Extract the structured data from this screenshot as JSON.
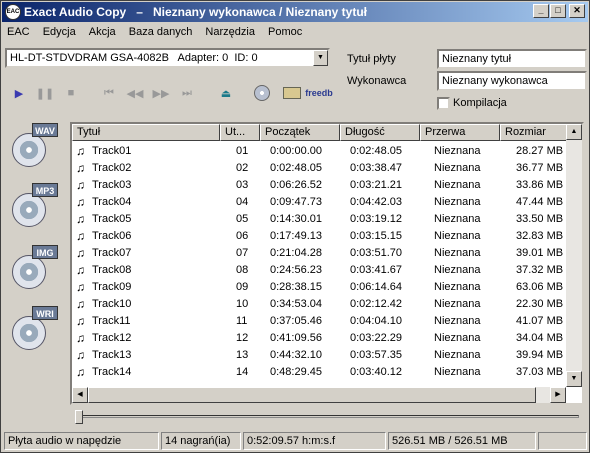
{
  "title": {
    "app": "Exact Audio Copy",
    "separator": "–",
    "album": "Nieznany wykonawca / Nieznany tytuł"
  },
  "menu": [
    "EAC",
    "Edycja",
    "Akcja",
    "Baza danych",
    "Narzędzia",
    "Pomoc"
  ],
  "drive": {
    "selected": "HL-DT-STDVDRAM GSA-4082B   Adapter: 0  ID: 0"
  },
  "fields": {
    "album_title_label": "Tytuł płyty",
    "album_title_value": "Nieznany tytuł",
    "artist_label": "Wykonawca",
    "artist_value": "Nieznany wykonawca",
    "compilation_label": "Kompilacja"
  },
  "transport_icons": [
    "play-icon",
    "pause-icon",
    "stop-icon",
    "first-track-icon",
    "rewind-icon",
    "fast-forward-icon",
    "last-track-icon",
    "eject-icon",
    "cd-icon",
    "network-icon",
    "freedb-icon"
  ],
  "freedb_label": "freedb",
  "side_buttons": [
    {
      "tag": "WAV",
      "name": "copy-wav-button"
    },
    {
      "tag": "MP3",
      "name": "copy-mp3-button"
    },
    {
      "tag": "IMG",
      "name": "copy-image-button"
    },
    {
      "tag": "WRI",
      "name": "write-cd-button"
    }
  ],
  "table": {
    "columns": [
      "Tytuł",
      "Ut...",
      "Początek",
      "Długość",
      "Przerwa",
      "Rozmiar"
    ],
    "rows": [
      [
        "Track01",
        "01",
        "0:00:00.00",
        "0:02:48.05",
        "Nieznana",
        "28.27 MB"
      ],
      [
        "Track02",
        "02",
        "0:02:48.05",
        "0:03:38.47",
        "Nieznana",
        "36.77 MB"
      ],
      [
        "Track03",
        "03",
        "0:06:26.52",
        "0:03:21.21",
        "Nieznana",
        "33.86 MB"
      ],
      [
        "Track04",
        "04",
        "0:09:47.73",
        "0:04:42.03",
        "Nieznana",
        "47.44 MB"
      ],
      [
        "Track05",
        "05",
        "0:14:30.01",
        "0:03:19.12",
        "Nieznana",
        "33.50 MB"
      ],
      [
        "Track06",
        "06",
        "0:17:49.13",
        "0:03:15.15",
        "Nieznana",
        "32.83 MB"
      ],
      [
        "Track07",
        "07",
        "0:21:04.28",
        "0:03:51.70",
        "Nieznana",
        "39.01 MB"
      ],
      [
        "Track08",
        "08",
        "0:24:56.23",
        "0:03:41.67",
        "Nieznana",
        "37.32 MB"
      ],
      [
        "Track09",
        "09",
        "0:28:38.15",
        "0:06:14.64",
        "Nieznana",
        "63.06 MB"
      ],
      [
        "Track10",
        "10",
        "0:34:53.04",
        "0:02:12.42",
        "Nieznana",
        "22.30 MB"
      ],
      [
        "Track11",
        "11",
        "0:37:05.46",
        "0:04:04.10",
        "Nieznana",
        "41.07 MB"
      ],
      [
        "Track12",
        "12",
        "0:41:09.56",
        "0:03:22.29",
        "Nieznana",
        "34.04 MB"
      ],
      [
        "Track13",
        "13",
        "0:44:32.10",
        "0:03:57.35",
        "Nieznana",
        "39.94 MB"
      ],
      [
        "Track14",
        "14",
        "0:48:29.45",
        "0:03:40.12",
        "Nieznana",
        "37.03 MB"
      ]
    ]
  },
  "status": {
    "disc": "Płyta audio w napędzie",
    "tracks": "14 nagrań(ia)",
    "length": "0:52:09.57 h:m:s.f",
    "size": "526.51 MB / 526.51 MB",
    "extra": ""
  }
}
